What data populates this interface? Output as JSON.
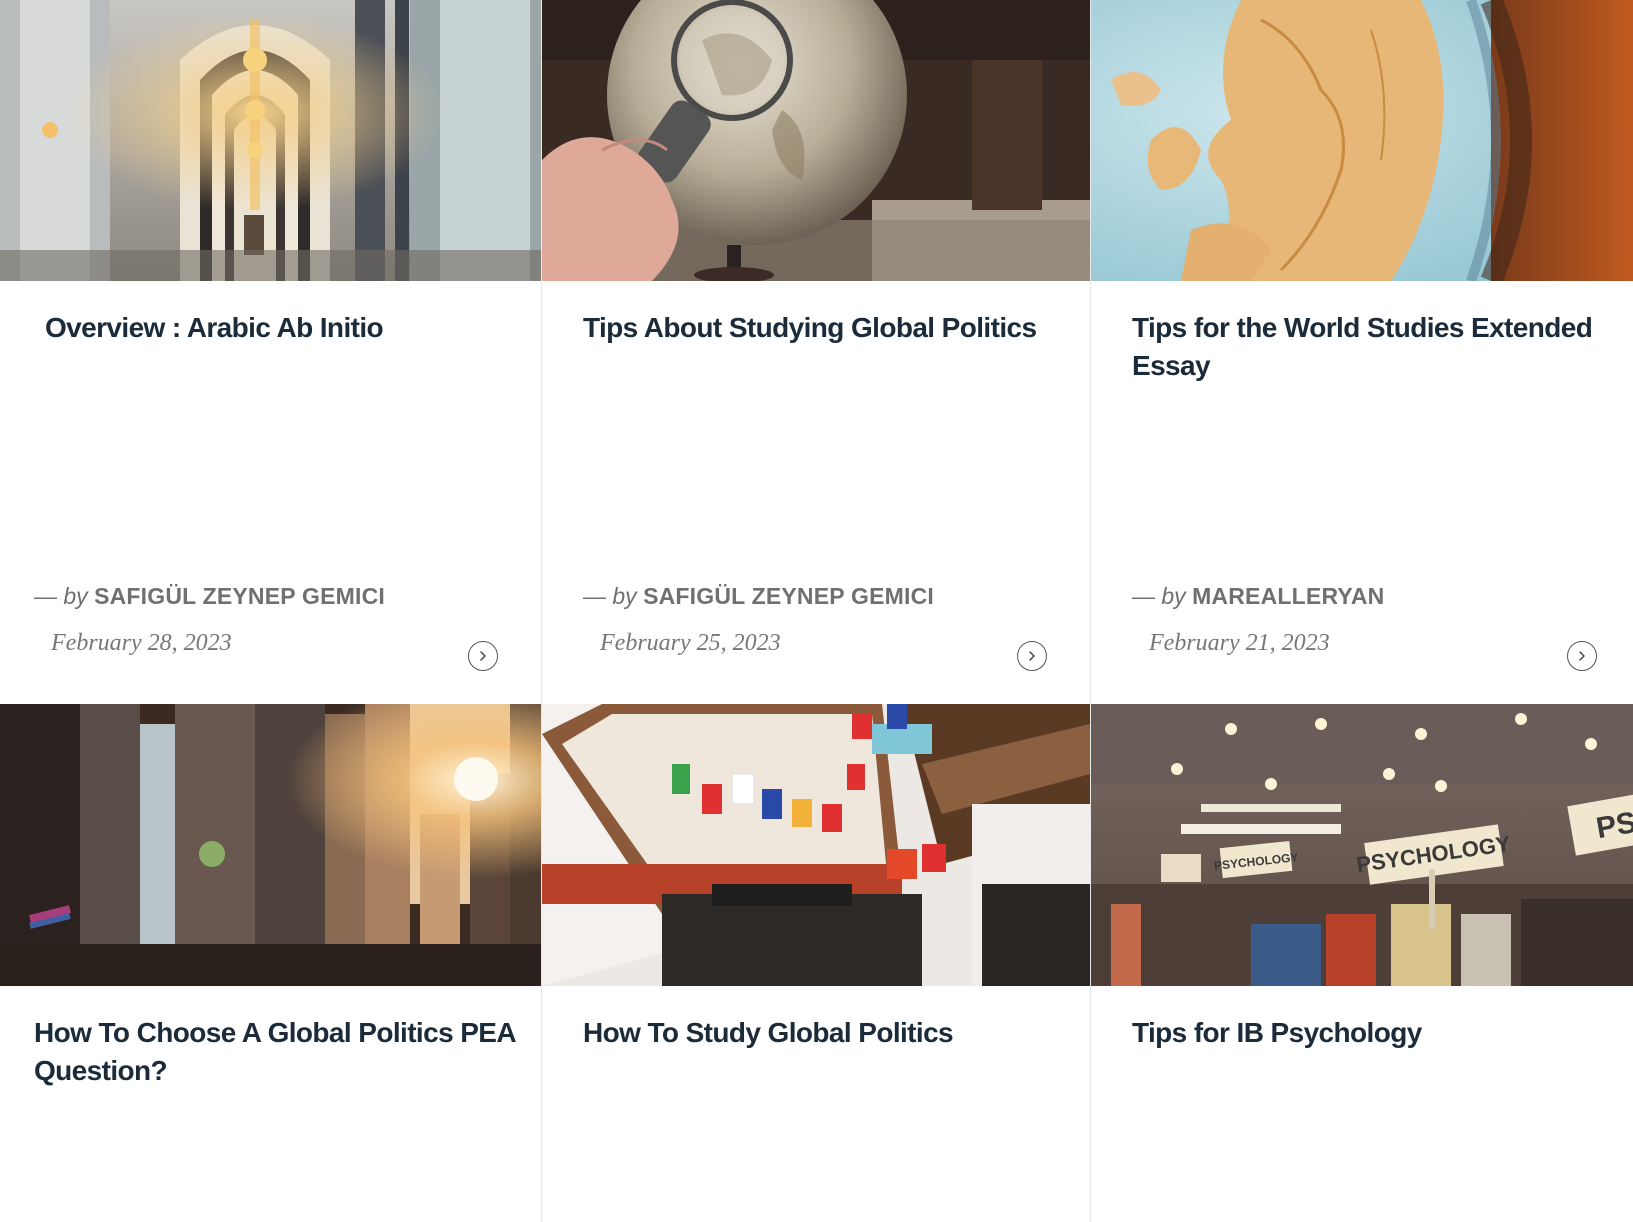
{
  "cards": [
    {
      "title": "Overview : Arabic Ab Initio",
      "by": "— by",
      "author": "SAFIGÜL ZEYNEP GEMICI",
      "date": "February 28, 2023",
      "image": "mosque-corridor-photo"
    },
    {
      "title": "Tips About Studying Global Politics",
      "by": "— by",
      "author": "SAFIGÜL ZEYNEP GEMICI",
      "date": "February 25, 2023",
      "image": "globe-magnifier-photo"
    },
    {
      "title": "Tips for the World Studies Extended Essay",
      "by": "— by",
      "author": "MAREALLERYAN",
      "date": "February 21, 2023",
      "image": "europe-globe-photo"
    },
    {
      "title": "How To Choose A Global Politics PEA Question?",
      "image": "city-street-sunset-photo"
    },
    {
      "title": "How To Study Global Politics",
      "image": "building-flags-photo"
    },
    {
      "title": "Tips for IB Psychology",
      "image": "psychology-bookstore-photo"
    }
  ],
  "more_icon": "chevron-right-circle-icon"
}
